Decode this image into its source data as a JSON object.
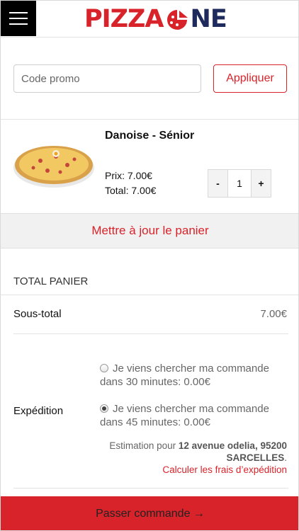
{
  "header": {
    "logo_part1": "PIZZA",
    "logo_part2": "NE",
    "brand_red": "#d8232a",
    "brand_navy": "#1f2a5c"
  },
  "promo": {
    "placeholder": "Code promo",
    "value": "",
    "apply_label": "Appliquer"
  },
  "cart_item": {
    "name": "Danoise - Sénior",
    "price": "Prix: 7.00€",
    "total": "Total: 7.00€",
    "quantity": "1",
    "minus_label": "-",
    "plus_label": "+"
  },
  "update_cart_label": "Mettre à jour le panier",
  "totals": {
    "title": "TOTAL PANIER",
    "subtotal_label": "Sous-total",
    "subtotal_value": "7.00€",
    "shipping_label": "Expédition",
    "shipping_options": [
      {
        "label": "Je viens chercher ma commande dans 30 minutes: 0.00€",
        "selected": false
      },
      {
        "label": "Je viens chercher ma commande dans 45 minutes: 0.00€",
        "selected": true
      }
    ],
    "estimate_prefix": "Estimation pour",
    "estimate_address": "12 avenue odelia, 95200 SARCELLES",
    "estimate_suffix": ".",
    "calc_link": "Calculer les frais d’expédition"
  },
  "checkout_label": "Passer commande →"
}
